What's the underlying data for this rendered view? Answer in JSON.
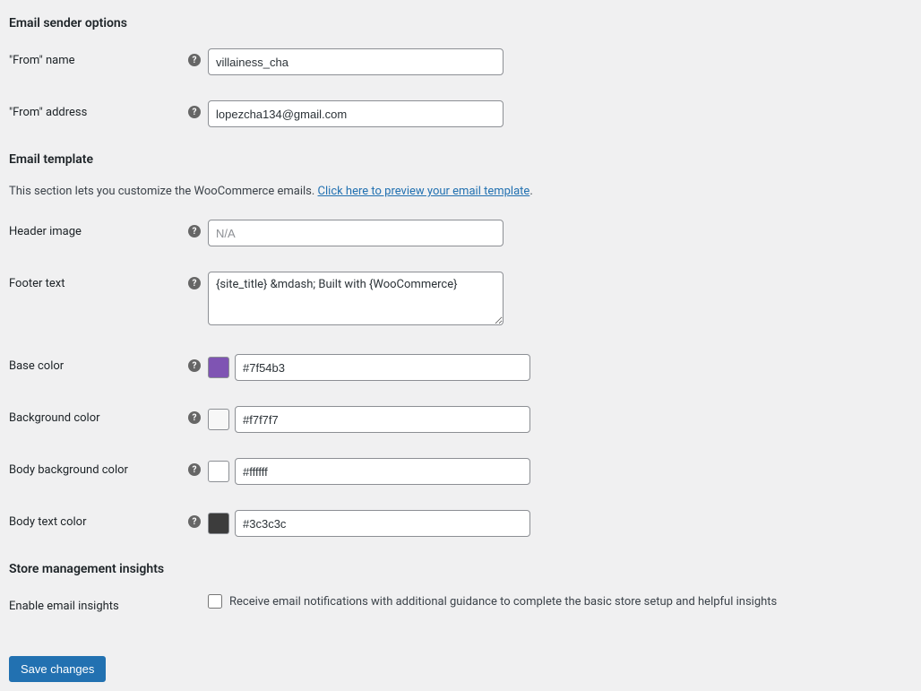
{
  "sender_options": {
    "heading": "Email sender options",
    "from_name": {
      "label": "\"From\" name",
      "value": "villainess_cha"
    },
    "from_address": {
      "label": "\"From\" address",
      "value": "lopezcha134@gmail.com"
    }
  },
  "template": {
    "heading": "Email template",
    "description_prefix": "This section lets you customize the WooCommerce emails. ",
    "description_link": "Click here to preview your email template",
    "description_suffix": ".",
    "header_image": {
      "label": "Header image",
      "placeholder": "N/A",
      "value": ""
    },
    "footer_text": {
      "label": "Footer text",
      "value": "{site_title} &mdash; Built with {WooCommerce}"
    },
    "base_color": {
      "label": "Base color",
      "value": "#7f54b3"
    },
    "background_color": {
      "label": "Background color",
      "value": "#f7f7f7"
    },
    "body_background_color": {
      "label": "Body background color",
      "value": "#ffffff"
    },
    "body_text_color": {
      "label": "Body text color",
      "value": "#3c3c3c"
    }
  },
  "insights": {
    "heading": "Store management insights",
    "enable": {
      "label": "Enable email insights",
      "checkbox_label": "Receive email notifications with additional guidance to complete the basic store setup and helpful insights"
    }
  },
  "actions": {
    "save": "Save changes"
  }
}
